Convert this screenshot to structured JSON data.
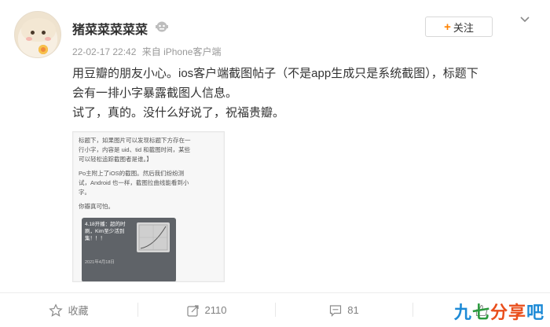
{
  "post": {
    "username": "猪菜菜菜菜菜",
    "date": "22-02-17 22:42",
    "source": "来自 iPhone客户端",
    "text_lines": [
      "用豆瓣的朋友小心。ios客户端截图帖子（不是app生成只是系统截图），标题下",
      "会有一排小字暴露截图人信息。",
      "试了，真的。没什么好说了，祝福贵瓣。"
    ]
  },
  "follow_button": {
    "label": "关注"
  },
  "screenshot": {
    "lines": [
      "标题下，如果图片可以发现标题下方存在一",
      "行小字，内容是 uid、tid 和截图时间，某些",
      "可以轻松追踪截图者是谁。】",
      "Po主附上了iOS的截图。然后我们纷纷测",
      "试，Android 也一样，截图拉曲线能看到小",
      "字。",
      "你瓣真可怕。"
    ],
    "card_lines": [
      "4.18开播：超的时",
      "刷，Kim至少活到",
      "集！！！"
    ],
    "card_footer": "2021年4月18日"
  },
  "actions": {
    "favorite_label": "收藏",
    "repost_count": "2110",
    "comment_count": "81"
  },
  "watermark": {
    "chars": [
      "九",
      "七",
      "分",
      "享",
      "吧"
    ],
    "colors": [
      "#1d8ad6",
      "#2b9a3e",
      "#e94e1b",
      "#e94e1b",
      "#1d8ad6"
    ]
  }
}
